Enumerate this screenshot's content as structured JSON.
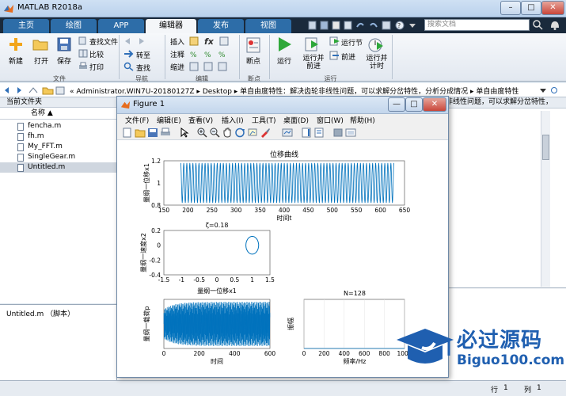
{
  "app": {
    "title": "MATLAB R2018a",
    "window_controls": [
      "–",
      "□",
      "✕"
    ]
  },
  "tabs": [
    {
      "label": "主页",
      "active": false
    },
    {
      "label": "绘图",
      "active": false
    },
    {
      "label": "APP",
      "active": false
    },
    {
      "label": "编辑器",
      "active": true
    },
    {
      "label": "发布",
      "active": false
    },
    {
      "label": "视图",
      "active": false
    }
  ],
  "search": {
    "placeholder": "搜索文档"
  },
  "ribbon": {
    "file_group": {
      "label": "文件",
      "new": "新建",
      "open": "打开",
      "save": "保存",
      "find_files": "查找文件",
      "compare": "比较",
      "print": "打印"
    },
    "nav_group": {
      "label": "导航",
      "goto": "转至",
      "find": "查找"
    },
    "edit_group": {
      "label": "编辑",
      "insert": "插入",
      "comment": "注释",
      "indent": "缩进",
      "fx": "fx"
    },
    "breakpoints_group": {
      "label": "断点",
      "breakpoints": "断点"
    },
    "run_group": {
      "label": "运行",
      "run": "运行",
      "run_advance": "运行并\n前进",
      "run_section": "运行节",
      "advance": "前进",
      "run_time": "运行并\n计时"
    }
  },
  "address": {
    "path": "« Administrator.WIN7U-20180127Z ▸ Desktop ▸ 单自由度特性：解决齿轮非线性问题，可以求解分岔特性，分析分成情况 ▸ 单自由度特性"
  },
  "current_folder": {
    "title": "当前文件夹",
    "column": "名称 ▲",
    "files": [
      {
        "name": "fencha.m",
        "selected": false
      },
      {
        "name": "fh.m",
        "selected": false
      },
      {
        "name": "My_FFT.m",
        "selected": false
      },
      {
        "name": "SingleGear.m",
        "selected": false
      },
      {
        "name": "Untitled.m",
        "selected": true
      }
    ]
  },
  "details": {
    "title": "Untitled.m （脚本）"
  },
  "editor": {
    "tab_text": "非线性问题，可以求解分岔特性，"
  },
  "status": {
    "row_label": "行",
    "row_value": "1",
    "col_label": "列",
    "col_value": "1"
  },
  "figure": {
    "title": "Figure 1",
    "menu": [
      "文件(F)",
      "编辑(E)",
      "查看(V)",
      "插入(I)",
      "工具(T)",
      "桌面(D)",
      "窗口(W)",
      "帮助(H)"
    ],
    "window_controls": [
      "—",
      "□",
      "✕"
    ]
  },
  "watermark": {
    "main": "必过源码",
    "sub": "Biguo100.com"
  },
  "chart_data": [
    {
      "type": "line",
      "title": "位移曲线",
      "xlabel": "时间t",
      "ylabel": "量纲一位移x1",
      "xlim": [
        150,
        650
      ],
      "ylim": [
        0.8,
        1.2
      ],
      "xticks": [
        150,
        200,
        250,
        300,
        350,
        400,
        450,
        500,
        550,
        600,
        650
      ],
      "yticks": [
        0.8,
        1,
        1.2
      ],
      "x_range": [
        185,
        628
      ],
      "oscillation": {
        "mean": 1.0,
        "amplitude": 0.18,
        "cycles": 70
      },
      "color": "#0072bd"
    },
    {
      "type": "line",
      "title": "ζ=0.18",
      "xlabel": "量纲一位移x1",
      "ylabel": "量纲一速度x2",
      "xlim": [
        -1.5,
        1.5
      ],
      "ylim": [
        -0.4,
        0.2
      ],
      "xticks": [
        -1.5,
        -1,
        -0.5,
        0,
        0.5,
        1,
        1.5
      ],
      "yticks": [
        -0.4,
        -0.2,
        0,
        0.2
      ],
      "orbit": {
        "center_x": 1.0,
        "center_y": 0.0,
        "radius_x": 0.18,
        "radius_y": 0.12
      },
      "color": "#0072bd"
    },
    {
      "type": "line",
      "title": "",
      "xlabel": "时间",
      "ylabel": "量纲一载荷p",
      "xlim": [
        0,
        600
      ],
      "ylim": [
        -1,
        1
      ],
      "xticks": [
        0,
        200,
        400,
        600
      ],
      "color": "#0072bd"
    },
    {
      "type": "line",
      "title": "N=128",
      "xlabel": "频率/Hz",
      "ylabel": "振幅",
      "xlim": [
        0,
        1000
      ],
      "ylim": [
        0,
        1
      ],
      "xticks": [
        0,
        200,
        400,
        600,
        800,
        1000
      ],
      "color": "#0072bd"
    }
  ]
}
